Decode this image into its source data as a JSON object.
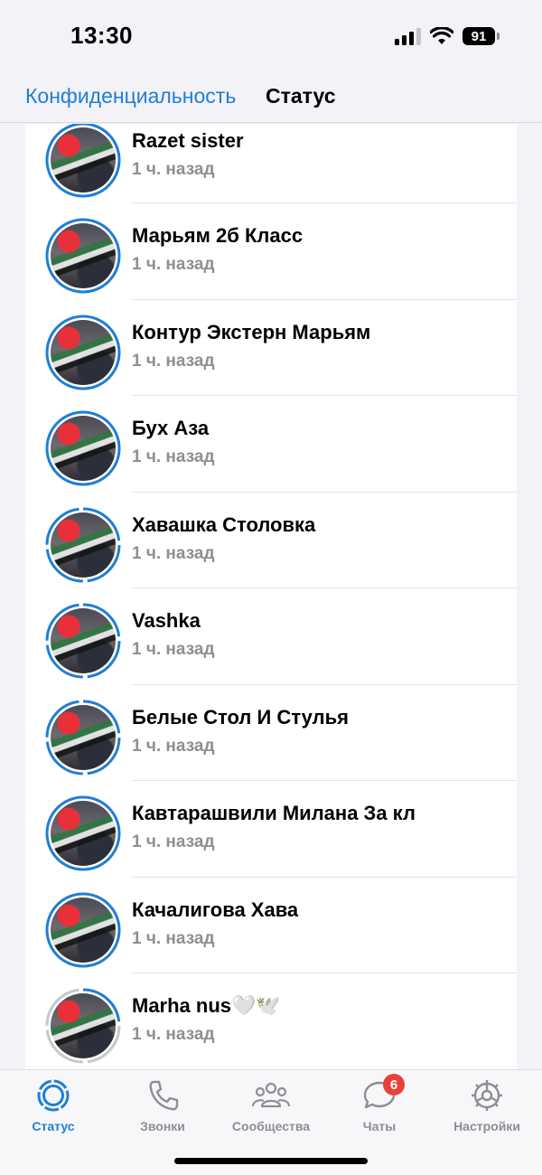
{
  "status_bar": {
    "time": "13:30",
    "battery": "91"
  },
  "nav": {
    "back_label": "Конфиденциальность",
    "title": "Статус"
  },
  "contacts": [
    {
      "name": "Razet sister",
      "time": "1 ч. назад",
      "ring": "full"
    },
    {
      "name": "Марьям 2б Класс",
      "time": "1 ч. назад",
      "ring": "full"
    },
    {
      "name": "Контур Экстерн Марьям",
      "time": "1 ч. назад",
      "ring": "full"
    },
    {
      "name": "Бух Аза",
      "time": "1 ч. назад",
      "ring": "full"
    },
    {
      "name": "Хавашка Столовка",
      "time": "1 ч. назад",
      "ring": "segmented"
    },
    {
      "name": "Vashka",
      "time": "1 ч. назад",
      "ring": "segmented"
    },
    {
      "name": "Белые Стол И Стулья",
      "time": "1 ч. назад",
      "ring": "segmented"
    },
    {
      "name": "Кавтарашвили Милана За кл",
      "time": "1 ч. назад",
      "ring": "full"
    },
    {
      "name": "Качалигова Хава",
      "time": "1 ч. назад",
      "ring": "full"
    },
    {
      "name": "Marha nus🤍🕊️",
      "time": "1 ч. назад",
      "ring": "partial-seen"
    }
  ],
  "tabs": [
    {
      "label": "Статус",
      "icon": "status-icon",
      "active": true
    },
    {
      "label": "Звонки",
      "icon": "phone-icon",
      "active": false
    },
    {
      "label": "Сообщества",
      "icon": "communities-icon",
      "active": false
    },
    {
      "label": "Чаты",
      "icon": "chats-icon",
      "active": false,
      "badge": "6"
    },
    {
      "label": "Настройки",
      "icon": "settings-icon",
      "active": false
    }
  ],
  "colors": {
    "accent": "#1f7ed6",
    "seen_ring": "#c7c7cc",
    "badge": "#e8413a"
  }
}
